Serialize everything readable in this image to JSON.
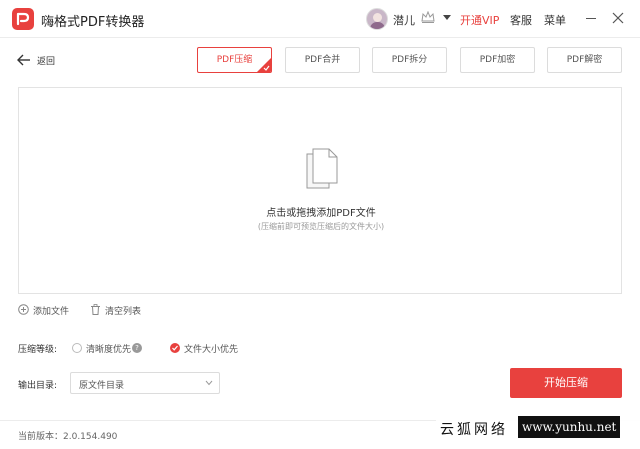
{
  "titlebar": {
    "app_title": "嗨格式PDF转换器",
    "username": "潜儿",
    "vip_link": "开通VIP",
    "service_link": "客服",
    "menu_link": "菜单"
  },
  "toolbar": {
    "back_label": "返回",
    "tabs": [
      {
        "label": "PDF压缩",
        "active": true
      },
      {
        "label": "PDF合并",
        "active": false
      },
      {
        "label": "PDF拆分",
        "active": false
      },
      {
        "label": "PDF加密",
        "active": false
      },
      {
        "label": "PDF解密",
        "active": false
      }
    ]
  },
  "dropzone": {
    "title": "点击或拖拽添加PDF文件",
    "subtitle": "(压缩前即可预览压缩后的文件大小)"
  },
  "actions": {
    "add_file": "添加文件",
    "clear_list": "清空列表"
  },
  "compression": {
    "label": "压缩等级:",
    "options": [
      {
        "label": "清晰度优先",
        "checked": false
      },
      {
        "label": "文件大小优先",
        "checked": true
      }
    ]
  },
  "output": {
    "label": "输出目录:",
    "selected": "原文件目录"
  },
  "start_button": "开始压缩",
  "footer": {
    "version": "当前版本：2.0.154.490"
  },
  "watermark": {
    "text": "云狐网络",
    "url": "www.yunhu.net"
  },
  "colors": {
    "accent": "#e8413e",
    "border": "#dcdcdc"
  }
}
